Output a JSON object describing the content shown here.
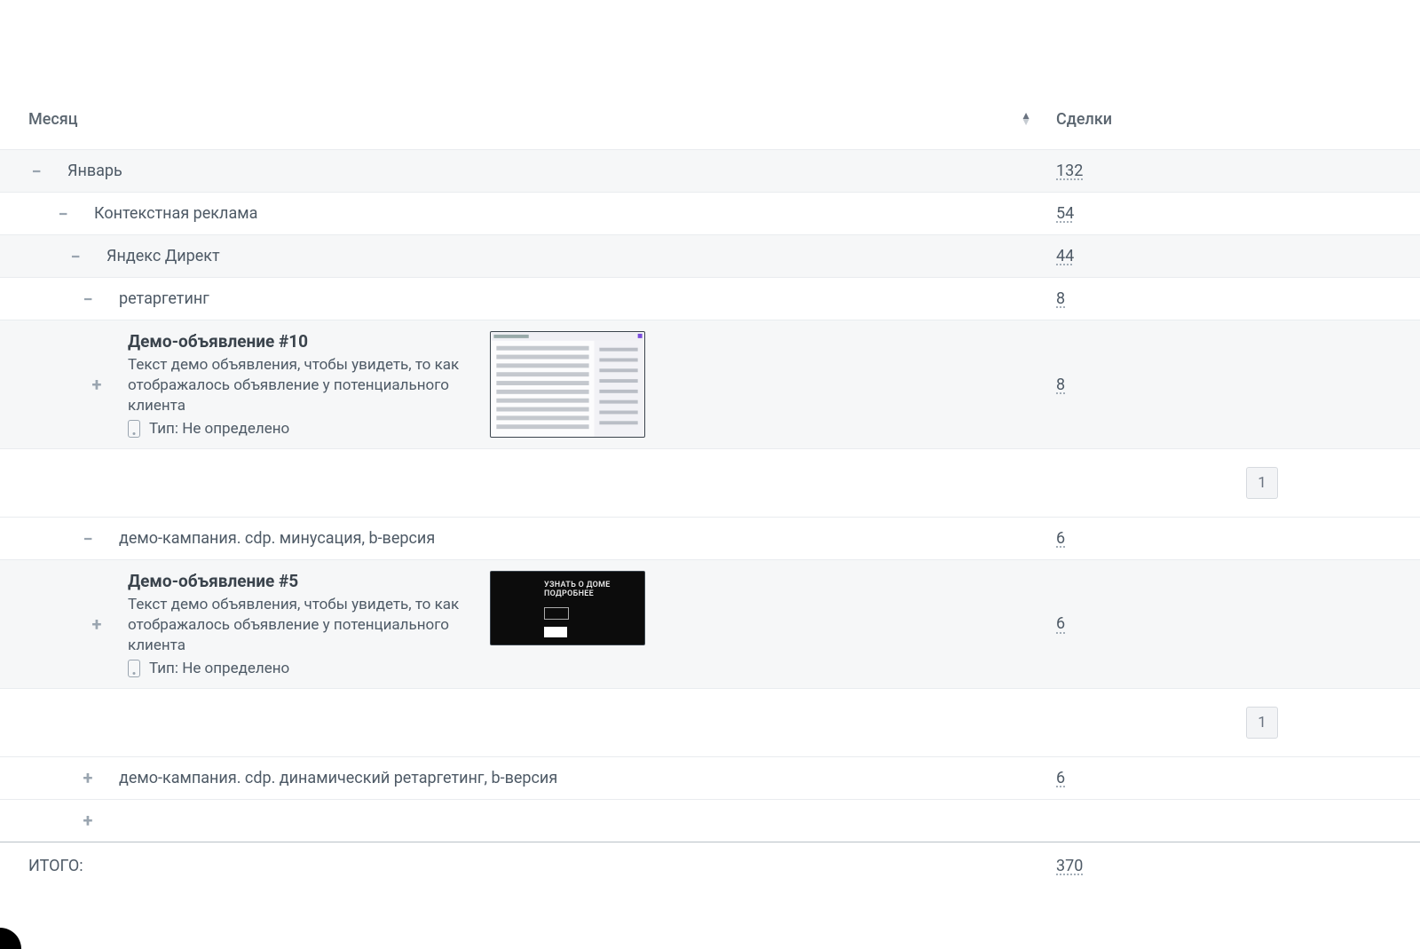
{
  "headers": {
    "month": "Месяц",
    "deals": "Сделки"
  },
  "rows": {
    "january": {
      "label": "Январь",
      "value": "132"
    },
    "context": {
      "label": "Контекстная реклама",
      "value": "54"
    },
    "yandex": {
      "label": "Яндекс Директ",
      "value": "44"
    },
    "retarget": {
      "label": "ретаргетинг",
      "value": "8"
    },
    "ad10": {
      "title": "Демо-объявление #10",
      "desc": "Текст демо объявления, чтобы увидеть, то как отображалось объявление у потенциального клиента",
      "type": "Тип: Не определено",
      "value": "8"
    },
    "camp_minus": {
      "label": "демо-кампания. cdp. минусация, b-версия",
      "value": "6"
    },
    "ad5": {
      "title": "Демо-объявление #5",
      "desc": "Текст демо объявления, чтобы увидеть, то как отображалось объявление у потенциального клиента",
      "type": "Тип: Не определено",
      "value": "6",
      "banner_line1": "УЗНАТЬ О ДОМЕ",
      "banner_line2": "ПОДРОБНЕЕ"
    },
    "camp_dyn": {
      "label": "демо-кампания. cdp. динамический ретаргетинг, b-версия",
      "value": "6"
    }
  },
  "pagination": {
    "page": "1"
  },
  "total": {
    "label": "ИТОГО:",
    "value": "370"
  }
}
